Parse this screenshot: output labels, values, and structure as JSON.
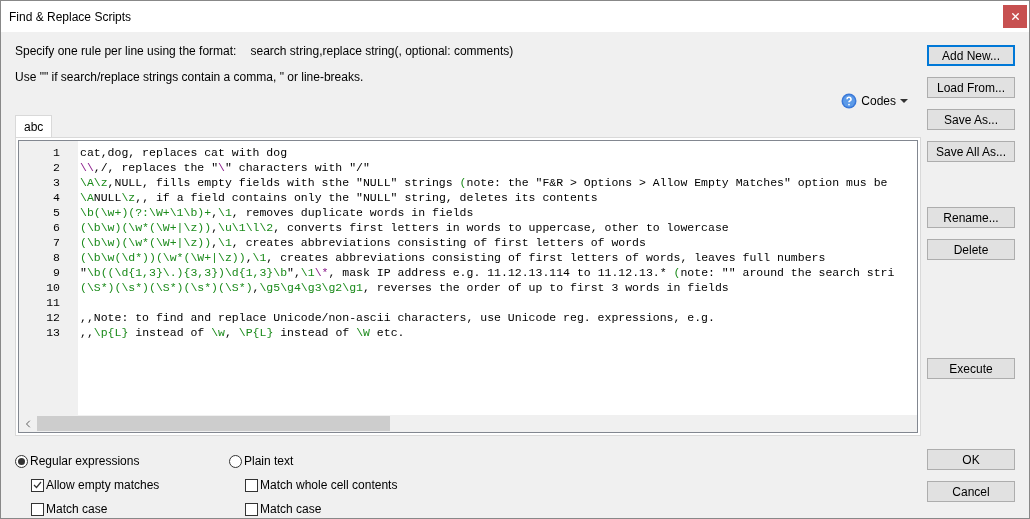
{
  "window": {
    "title": "Find & Replace Scripts"
  },
  "instructions": {
    "format_label": "Specify one rule per line using the format:",
    "format": "search string,replace string(, optional: comments)",
    "note": "Use \"\" if search/replace strings contain a comma, \" or line-breaks."
  },
  "codes_menu": {
    "label": "Codes"
  },
  "tabs": [
    {
      "label": "abc",
      "selected": true
    }
  ],
  "editor": {
    "lines": [
      {
        "number": "1",
        "segments": [
          {
            "kind": "plain",
            "text": "cat,dog, replaces cat with dog"
          }
        ]
      },
      {
        "number": "2",
        "segments": [
          {
            "kind": "escape",
            "text": "\\\\"
          },
          {
            "kind": "plain",
            "text": ",/, replaces the \""
          },
          {
            "kind": "escape",
            "text": "\\"
          },
          {
            "kind": "plain",
            "text": "\" characters with \"/\""
          }
        ]
      },
      {
        "number": "3",
        "segments": [
          {
            "kind": "regex",
            "text": "\\A\\z"
          },
          {
            "kind": "plain",
            "text": ",NULL, fills empty fields with sthe \"NULL\" strings "
          },
          {
            "kind": "regex",
            "text": "("
          },
          {
            "kind": "plain",
            "text": "note: the \"F&R > Options > Allow Empty Matches\" option mus be"
          }
        ]
      },
      {
        "number": "4",
        "segments": [
          {
            "kind": "regex",
            "text": "\\A"
          },
          {
            "kind": "plain",
            "text": "NULL"
          },
          {
            "kind": "regex",
            "text": "\\z"
          },
          {
            "kind": "plain",
            "text": ",, if a field contains only the \"NULL\" string, deletes its contents"
          }
        ]
      },
      {
        "number": "5",
        "segments": [
          {
            "kind": "regex",
            "text": "\\b(\\w+)(?:\\W+\\1\\b)+"
          },
          {
            "kind": "plain",
            "text": ","
          },
          {
            "kind": "regex",
            "text": "\\1"
          },
          {
            "kind": "plain",
            "text": ", removes duplicate words in fields"
          }
        ]
      },
      {
        "number": "6",
        "segments": [
          {
            "kind": "regex",
            "text": "(\\b\\w)(\\w*(\\W+|\\z))"
          },
          {
            "kind": "plain",
            "text": ","
          },
          {
            "kind": "regex",
            "text": "\\u\\1\\l\\2"
          },
          {
            "kind": "plain",
            "text": ", converts first letters in words to uppercase, other to lowercase"
          }
        ]
      },
      {
        "number": "7",
        "segments": [
          {
            "kind": "regex",
            "text": "(\\b\\w)(\\w*(\\W+|\\z))"
          },
          {
            "kind": "plain",
            "text": ","
          },
          {
            "kind": "regex",
            "text": "\\1"
          },
          {
            "kind": "plain",
            "text": ", creates abbreviations consisting of first letters of words"
          }
        ]
      },
      {
        "number": "8",
        "segments": [
          {
            "kind": "regex",
            "text": "(\\b\\w(\\d*))(\\w*(\\W+|\\z))"
          },
          {
            "kind": "plain",
            "text": ","
          },
          {
            "kind": "regex",
            "text": "\\1"
          },
          {
            "kind": "plain",
            "text": ", creates abbreviations consisting of first letters of words, leaves full numbers"
          }
        ]
      },
      {
        "number": "9",
        "segments": [
          {
            "kind": "plain",
            "text": "\""
          },
          {
            "kind": "regex",
            "text": "\\b((\\d{1,3}\\.){3,3})\\d{1,3}\\b"
          },
          {
            "kind": "plain",
            "text": "\","
          },
          {
            "kind": "regex",
            "text": "\\1"
          },
          {
            "kind": "escape",
            "text": "\\*"
          },
          {
            "kind": "plain",
            "text": ", mask IP address e.g. 11.12.13.114 to 11.12.13.* "
          },
          {
            "kind": "regex",
            "text": "("
          },
          {
            "kind": "plain",
            "text": "note: \"\" around the search stri"
          }
        ]
      },
      {
        "number": "10",
        "segments": [
          {
            "kind": "regex",
            "text": "(\\S*)(\\s*)(\\S*)(\\s*)(\\S*)"
          },
          {
            "kind": "plain",
            "text": ","
          },
          {
            "kind": "regex",
            "text": "\\g5\\g4\\g3\\g2\\g1"
          },
          {
            "kind": "plain",
            "text": ", reverses the order of up to first 3 words in fields"
          }
        ]
      },
      {
        "number": "11"
      },
      {
        "number": "12",
        "segments": [
          {
            "kind": "plain",
            "text": ",,Note: to find and replace Unicode/non-ascii characters, use Unicode reg. expressions, e.g."
          }
        ]
      },
      {
        "number": "13",
        "segments": [
          {
            "kind": "plain",
            "text": ",,"
          },
          {
            "kind": "regex",
            "text": "\\p{L}"
          },
          {
            "kind": "plain",
            "text": " instead of "
          },
          {
            "kind": "regex",
            "text": "\\w"
          },
          {
            "kind": "plain",
            "text": ", "
          },
          {
            "kind": "regex",
            "text": "\\P{L}"
          },
          {
            "kind": "plain",
            "text": " instead of "
          },
          {
            "kind": "regex",
            "text": "\\W"
          },
          {
            "kind": "plain",
            "text": " etc."
          }
        ]
      }
    ]
  },
  "modes": [
    {
      "label": "Regular expressions",
      "selected": true,
      "options": [
        {
          "label": "Allow empty matches",
          "checked": true
        },
        {
          "label": "Match case",
          "checked": false
        }
      ]
    },
    {
      "label": "Plain text",
      "selected": false,
      "options": [
        {
          "label": "Match whole cell contents",
          "checked": false
        },
        {
          "label": "Match case",
          "checked": false
        }
      ]
    }
  ],
  "button_groups": [
    {
      "buttons": [
        {
          "label": "Add New...",
          "focused": true
        },
        {
          "label": "Load From...",
          "focused": false
        },
        {
          "label": "Save As...",
          "focused": false
        },
        {
          "label": "Save All As...",
          "focused": false
        }
      ]
    },
    {
      "buttons": [
        {
          "label": "Rename...",
          "focused": false
        },
        {
          "label": "Delete",
          "focused": false
        }
      ]
    },
    {
      "buttons": [
        {
          "label": "Execute",
          "focused": false
        }
      ]
    },
    {
      "buttons": [
        {
          "label": "OK",
          "focused": false
        },
        {
          "label": "Cancel",
          "focused": false
        }
      ]
    }
  ]
}
